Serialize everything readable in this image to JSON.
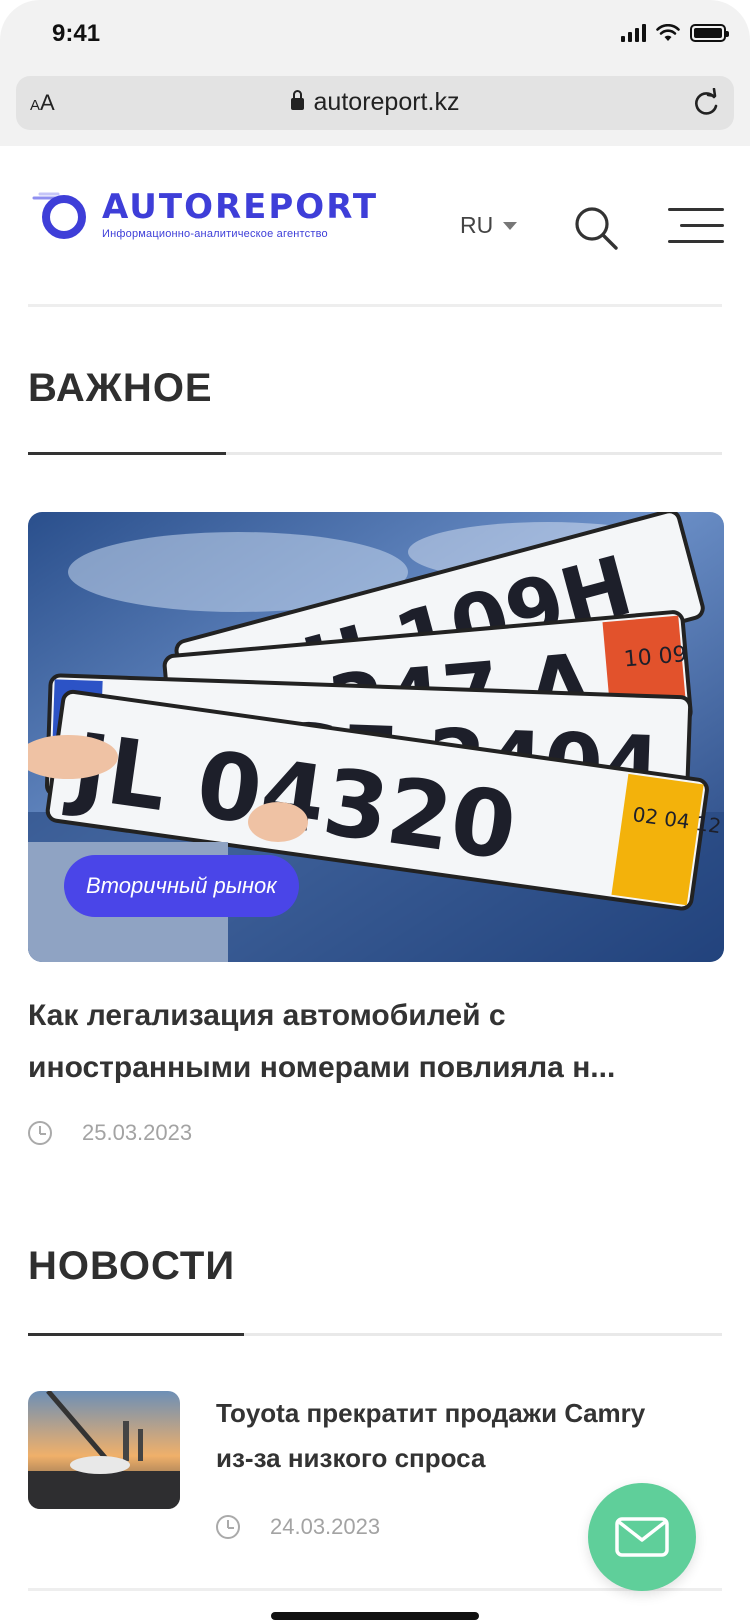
{
  "status_bar": {
    "time": "9:41"
  },
  "browser": {
    "text_size_label": "AA",
    "url": "autoreport.kz"
  },
  "header": {
    "logo_name": "AUTOREPORT",
    "logo_tagline": "Информационно-аналитическое агентство",
    "language": "RU"
  },
  "important": {
    "title": "ВАЖНОЕ",
    "article": {
      "category": "Вторичный рынок",
      "title": "Как легализация автомобилей с иностранными номерами повлияла н...",
      "date": "25.03.2023",
      "plates": [
        {
          "text": "U 109H"
        },
        {
          "text": "247 A",
          "sticker": "10 09"
        },
        {
          "text": "OP SE 2404"
        },
        {
          "text": "JL 04320",
          "sticker": "02 04 12"
        }
      ]
    }
  },
  "news": {
    "title": "НОВОСТИ",
    "items": [
      {
        "title": "Toyota прекратит продажи Camry из-за низкого спроса",
        "date": "24.03.2023"
      }
    ]
  },
  "colors": {
    "brand": "#3e3ed8",
    "badge": "#4a45e8",
    "fab": "#5fcf9a"
  },
  "icons": [
    "lock-icon",
    "reload-icon",
    "search-icon",
    "menu-icon",
    "clock-icon",
    "mail-icon"
  ]
}
